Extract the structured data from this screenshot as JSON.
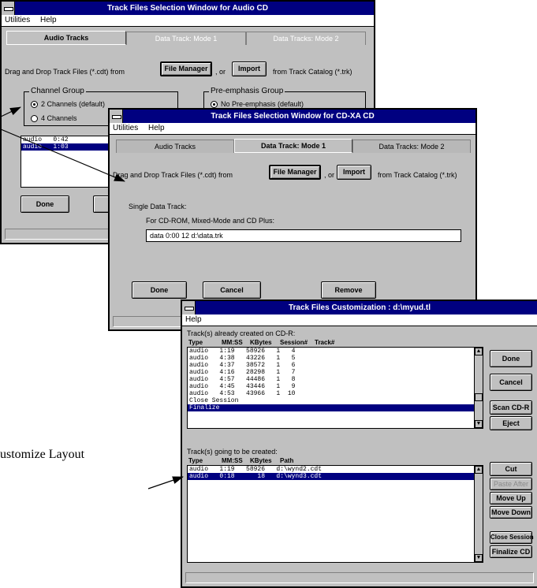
{
  "win_audio": {
    "title": "Track Files Selection Window for Audio CD",
    "menu": [
      "Utilities",
      "Help"
    ],
    "tabs": [
      "Audio Tracks",
      "Data Track: Mode 1",
      "Data Tracks: Mode 2"
    ],
    "drag_label": "Drag and Drop Track Files (*.cdt) from",
    "file_manager_btn": "File Manager",
    "or_label": ", or",
    "import_btn": "Import",
    "catalog_label": "from Track Catalog (*.trk)",
    "channel_group": "Channel Group",
    "channel_opt1": "2 Channels (default)",
    "channel_opt2": "4 Channels",
    "preemph_group": "Pre-emphasis Group",
    "preemph_opt1": "No Pre-emphasis (default)",
    "list_rows": [
      "audio   0:42",
      "audio   1:03"
    ],
    "done_btn": "Done"
  },
  "win_cdxa": {
    "title": "Track Files Selection Window for CD-XA CD",
    "menu": [
      "Utilities",
      "Help"
    ],
    "tabs": [
      "Audio Tracks",
      "Data Track: Mode 1",
      "Data Tracks: Mode 2"
    ],
    "drag_label": "Drag and Drop Track Files (*.cdt) from",
    "file_manager_btn": "File Manager",
    "or_label": ", or",
    "import_btn": "Import",
    "catalog_label": "from Track Catalog (*.trk)",
    "single_label": "Single Data Track:",
    "for_label": "For CD-ROM, Mixed-Mode and CD Plus:",
    "data_field": "data   0:00    12   d:\\data.trk",
    "done_btn": "Done",
    "cancel_btn": "Cancel",
    "remove_btn": "Remove"
  },
  "win_custom": {
    "title": "Track Files Customization : d:\\myud.tl",
    "menu": [
      "Help"
    ],
    "created_label": "Track(s) already created on CD-R:",
    "created_headers": [
      "Type",
      "MM:SS",
      "KBytes",
      "Session#",
      "Track#"
    ],
    "created_rows": [
      "audio   1:19   58926   1   4",
      "audio   4:38   43226   1   5",
      "audio   4:37   38572   1   6",
      "audio   4:16   28298   1   7",
      "audio   4:57   44486   1   8",
      "audio   4:45   43446   1   9",
      "audio   4:53   43966   1  10",
      "Close Session",
      "Finalize"
    ],
    "right_btns_top": [
      "Done",
      "Cancel",
      "Scan CD-R",
      "Eject"
    ],
    "tobe_label": "Track(s) going to be created:",
    "tobe_headers": [
      "Type",
      "MM:SS",
      "KBytes",
      "Path"
    ],
    "tobe_rows": [
      "audio   1:19   58926   d:\\wynd2.cdt",
      "audio   0:18      18   d:\\wynd3.cdt"
    ],
    "right_btns_bottom": [
      "Cut",
      "Paste After",
      "Move Up",
      "Move Down",
      "Close Session",
      "Finalize CD"
    ]
  },
  "callout_text": "ustomize Layout"
}
